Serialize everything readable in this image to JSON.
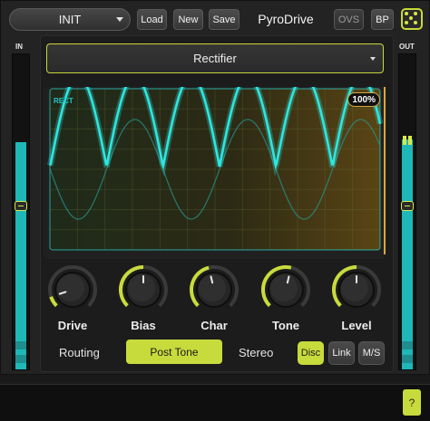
{
  "header": {
    "preset_name": "INIT",
    "load_label": "Load",
    "new_label": "New",
    "save_label": "Save",
    "plugin_title": "PyroDrive",
    "ovs_label": "OVS",
    "bp_label": "BP",
    "dice_icon": "dice-icon"
  },
  "meters": {
    "in_label": "IN",
    "out_label": "OUT",
    "in_level": 0.72,
    "out_level": 0.73,
    "in_gain_handle": 0.5,
    "out_gain_handle": 0.5
  },
  "mode": {
    "selected": "Rectifier"
  },
  "scope": {
    "waveform_label": "RECT",
    "mix_readout": "100%",
    "colors": {
      "wave": "#2ee6e0",
      "grid": "#3a4a30",
      "accent": "#d8a640"
    }
  },
  "knobs": [
    {
      "label": "Drive",
      "value": 0.1
    },
    {
      "label": "Bias",
      "value": 0.5
    },
    {
      "label": "Char",
      "value": 0.45
    },
    {
      "label": "Tone",
      "value": 0.55
    },
    {
      "label": "Level",
      "value": 0.5
    }
  ],
  "routing": {
    "label": "Routing",
    "value": "Post Tone"
  },
  "stereo": {
    "label": "Stereo",
    "options": [
      "Disc",
      "Link",
      "M/S"
    ],
    "selected": "Disc"
  },
  "footer": {
    "help_label": "?"
  },
  "colors": {
    "accent": "#c8db3c",
    "meter": "#1fb7b7"
  }
}
